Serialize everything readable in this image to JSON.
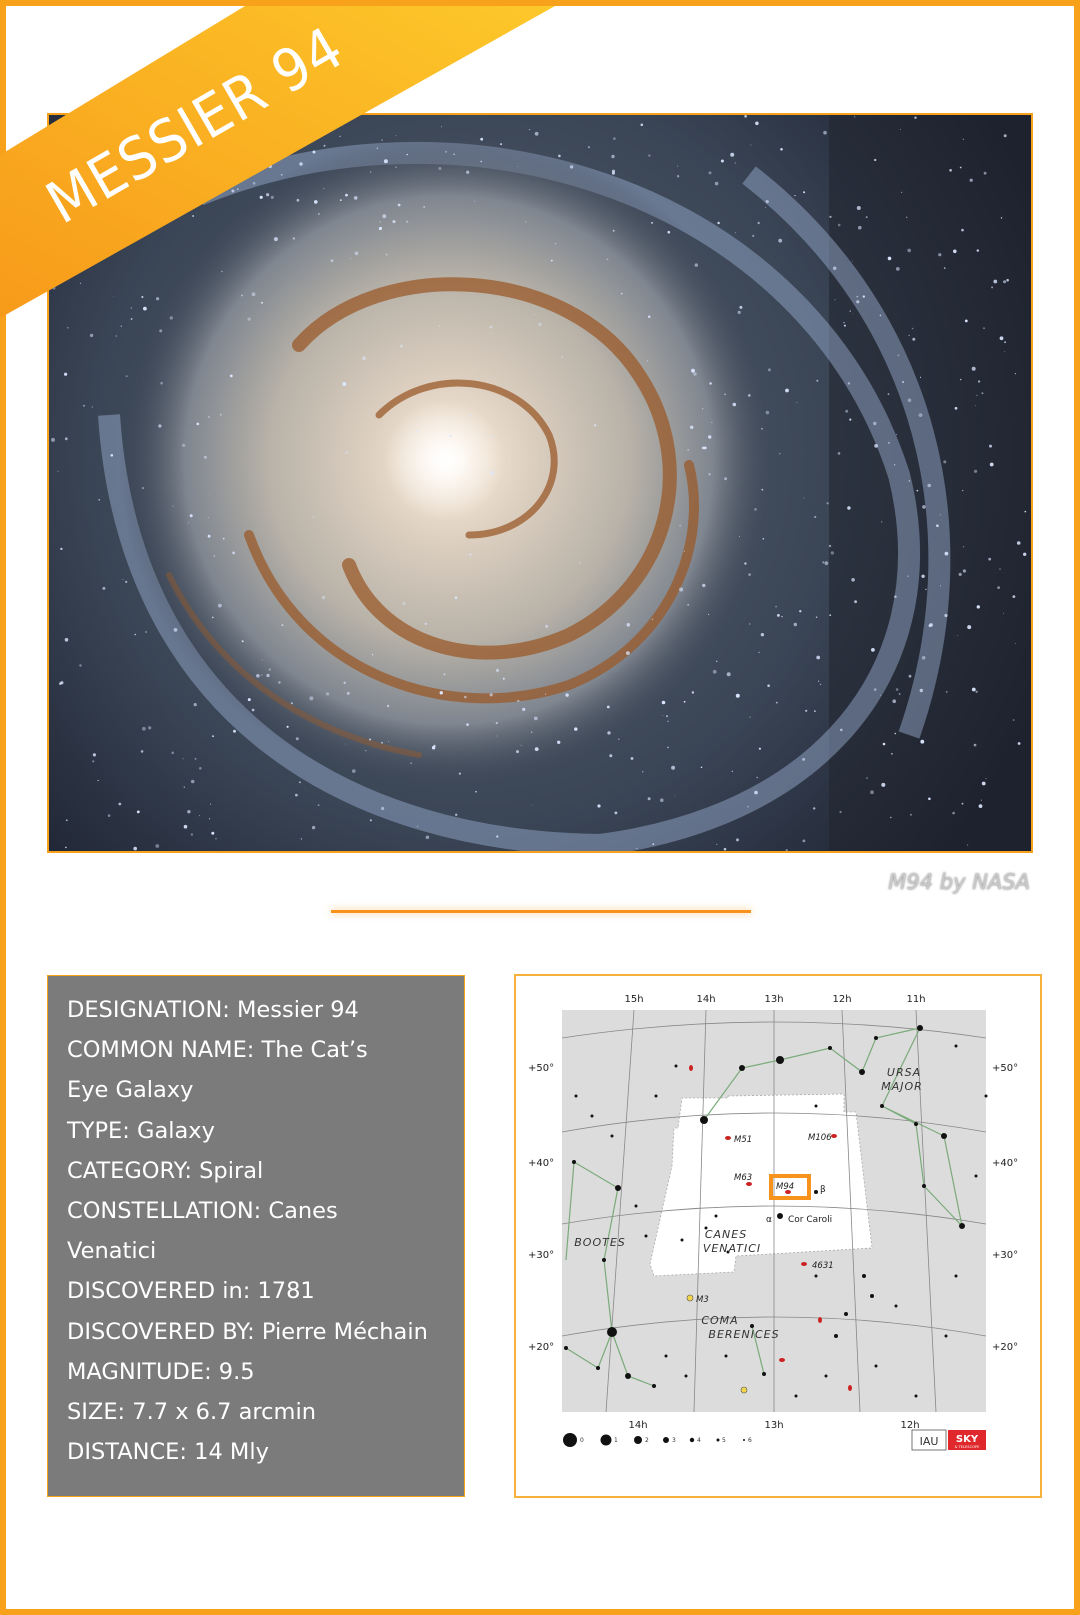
{
  "banner": {
    "title": "MESSIER 94"
  },
  "photo": {
    "credit": "M94 by NASA"
  },
  "info": {
    "rows": [
      "DESIGNATION: Messier 94",
      "COMMON NAME: The Cat’s",
      "Eye Galaxy",
      "TYPE: Galaxy",
      "CATEGORY: Spiral",
      "CONSTELLATION: Canes",
      "Venatici",
      "DISCOVERED in: 1781",
      "DISCOVERED BY: Pierre Méchain",
      "MAGNITUDE: 9.5",
      "SIZE: 7.7 x 6.7 arcmin",
      "DISTANCE: 14 Mly"
    ]
  },
  "map": {
    "ra_top": [
      "15h",
      "14h",
      "13h",
      "12h",
      "11h"
    ],
    "ra_bottom": [
      "14h",
      "13h",
      "12h"
    ],
    "dec_left": [
      "+50°",
      "+40°",
      "+30°",
      "+20°"
    ],
    "dec_right": [
      "+50°",
      "+40°",
      "+30°",
      "+20°"
    ],
    "constellations": {
      "canes_1": "CANES",
      "canes_2": "VENATICI",
      "ursa_1": "URSA",
      "ursa_2": "MAJOR",
      "bootes": "BOOTES",
      "coma_1": "COMA",
      "coma_2": "BERENICES"
    },
    "objects": {
      "m51": "M51",
      "m106": "M106",
      "m63": "M63",
      "m94": "M94",
      "ngc4631": "4631",
      "m3": "M3"
    },
    "stars": {
      "cor_caroli": "Cor Caroli",
      "alpha": "α",
      "beta": "β"
    },
    "magnitudes": [
      "0",
      "1",
      "2",
      "3",
      "4",
      "5",
      "6"
    ],
    "logo_iau": "IAU",
    "logo_sky": "SKY",
    "logo_sky_sub": "& TELESCOPE",
    "highlight_color": "#f7921a"
  },
  "colors": {
    "accent": "#f7921a",
    "info_bg": "#7b7b7b"
  }
}
